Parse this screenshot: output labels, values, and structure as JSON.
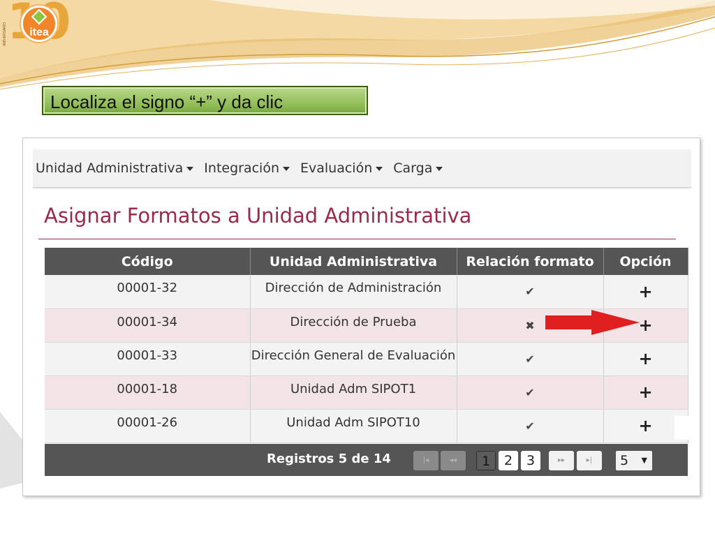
{
  "logo": {
    "text": "itea",
    "number": "10",
    "side_text": "ANIVERSARIO",
    "colors": {
      "orange": "#f0852a",
      "gold": "#e8a53a",
      "green": "#8cc63f"
    }
  },
  "instruction": {
    "text": "Localiza el signo “+” y da clic"
  },
  "nav": {
    "items": [
      {
        "label": "Unidad Administrativa"
      },
      {
        "label": "Integración"
      },
      {
        "label": "Evaluación"
      },
      {
        "label": "Carga"
      }
    ]
  },
  "page": {
    "title": "Asignar Formatos a Unidad Administrativa"
  },
  "table": {
    "headers": [
      "Código",
      "Unidad Administrativa",
      "Relación formato",
      "Opción"
    ],
    "rows": [
      {
        "code": "00001-32",
        "unit": "Dirección de Administración",
        "relation": "check",
        "relation_glyph": "✔",
        "option": "+"
      },
      {
        "code": "00001-34",
        "unit": "Dirección de Prueba",
        "relation": "cross",
        "relation_glyph": "✖",
        "option": "+"
      },
      {
        "code": "00001-33",
        "unit": "Dirección General de Evaluación",
        "relation": "check",
        "relation_glyph": "✔",
        "option": "+"
      },
      {
        "code": "00001-18",
        "unit": "Unidad Adm SIPOT1",
        "relation": "check",
        "relation_glyph": "✔",
        "option": "+"
      },
      {
        "code": "00001-26",
        "unit": "Unidad Adm SIPOT10",
        "relation": "check",
        "relation_glyph": "✔",
        "option": "+"
      }
    ]
  },
  "pager": {
    "info": "Registros 5 de 14",
    "first": "|◂",
    "prev": "◂◂",
    "pages": [
      "1",
      "2",
      "3"
    ],
    "current_page": "1",
    "next": "▸▸",
    "last": "▸|",
    "rows_per_page": "5",
    "dropdown_glyph": "▼"
  },
  "colors": {
    "title": "#9b2a4a",
    "header_bg": "#555555",
    "row_pink": "#f3e5e7",
    "arrow": "#e02020"
  }
}
